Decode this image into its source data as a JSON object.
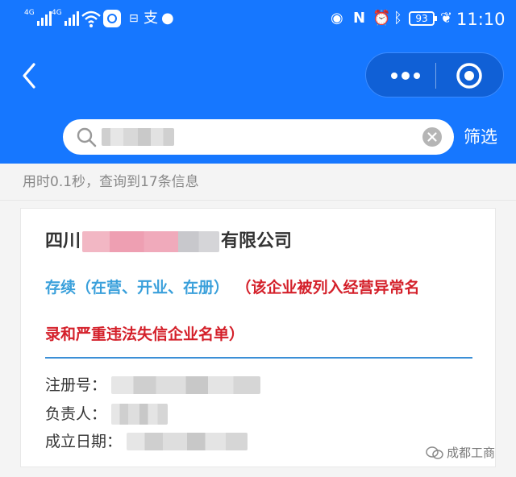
{
  "status_bar": {
    "signal1_label": "4G",
    "signal2_label": "4G",
    "battery": "93",
    "time": "11:10"
  },
  "nav": {
    "back_icon": "chevron-left-icon",
    "more_icon": "more-dots-icon",
    "close_icon": "target-circle-icon"
  },
  "search": {
    "value_masked": true,
    "filter_label": "筛选"
  },
  "summary": {
    "text": "用时0.1秒，查询到17条信息"
  },
  "result": {
    "name_prefix": "四川",
    "name_suffix": "有限公司",
    "status": "存续（在营、开业、在册）",
    "warning_line1": "（该企业被列入经营异常名",
    "warning_line2": "录和严重违法失信企业名单）",
    "fields": [
      {
        "label": "注册号："
      },
      {
        "label": "负责人："
      },
      {
        "label": "成立日期："
      }
    ]
  },
  "watermark": {
    "text": "成都工商"
  },
  "colors": {
    "brand_blue": "#1677ff",
    "status_blue": "#3aa0db",
    "warning_red": "#d4202a"
  }
}
